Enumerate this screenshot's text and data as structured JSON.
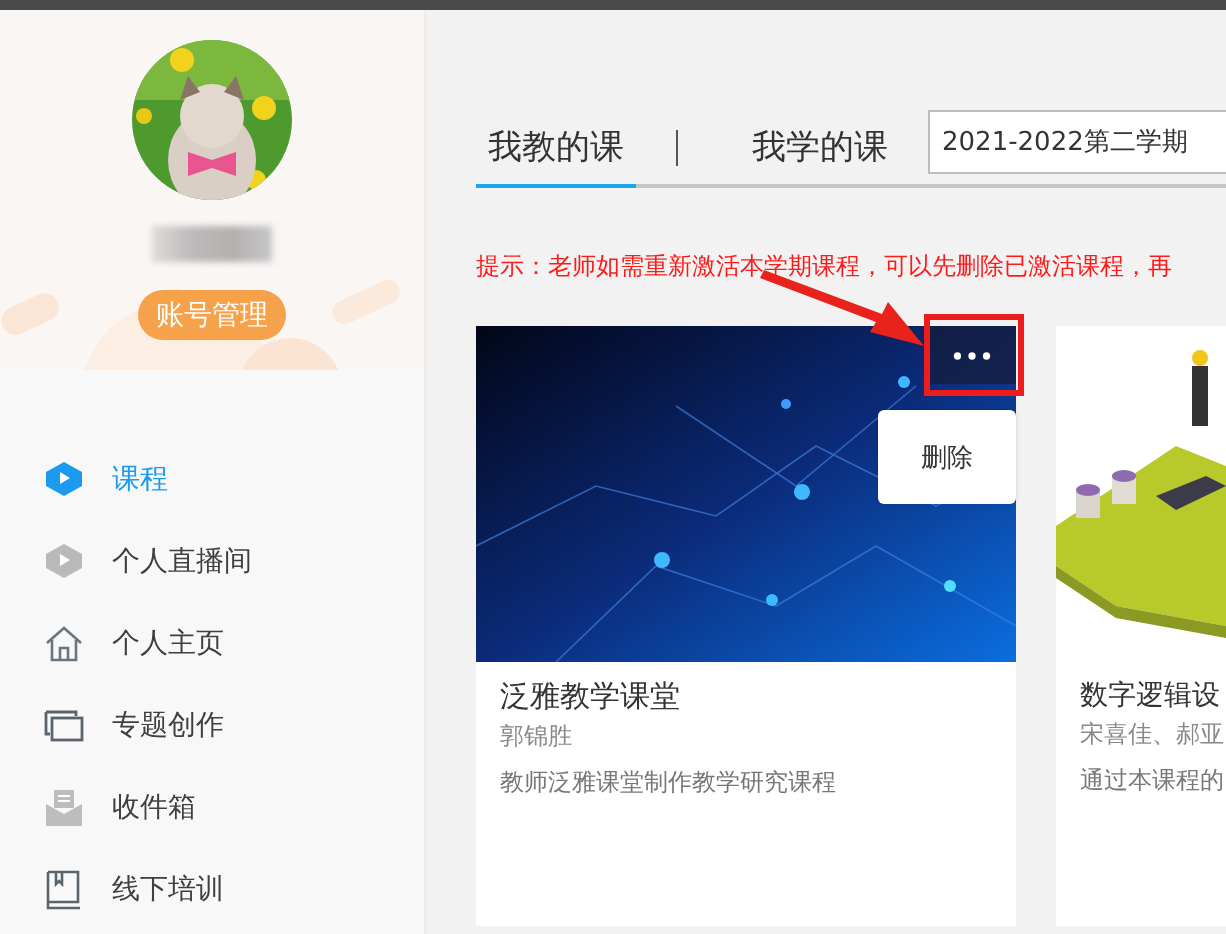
{
  "sidebar": {
    "account_button": "账号管理",
    "items": [
      {
        "label": "课程",
        "selected": true
      },
      {
        "label": "个人直播间",
        "selected": false
      },
      {
        "label": "个人主页",
        "selected": false
      },
      {
        "label": "专题创作",
        "selected": false
      },
      {
        "label": "收件箱",
        "selected": false
      },
      {
        "label": "线下培训",
        "selected": false
      }
    ]
  },
  "tabs": [
    {
      "label": "我教的课",
      "selected": true
    },
    {
      "label": "我学的课",
      "selected": false
    }
  ],
  "semester": {
    "value": "2021-2022第二学期"
  },
  "hint": "提示：老师如需重新激活本学期课程，可以先删除已激活课程，再",
  "courses": [
    {
      "title": "泛雅教学课堂",
      "teacher": "郭锦胜",
      "description": "教师泛雅课堂制作教学研究课程",
      "menu_open": true,
      "menu_items": [
        "删除"
      ]
    },
    {
      "title": "数字逻辑设",
      "teacher": "宋喜佳、郝亚",
      "description": "通过本课程的",
      "menu_open": false
    }
  ]
}
